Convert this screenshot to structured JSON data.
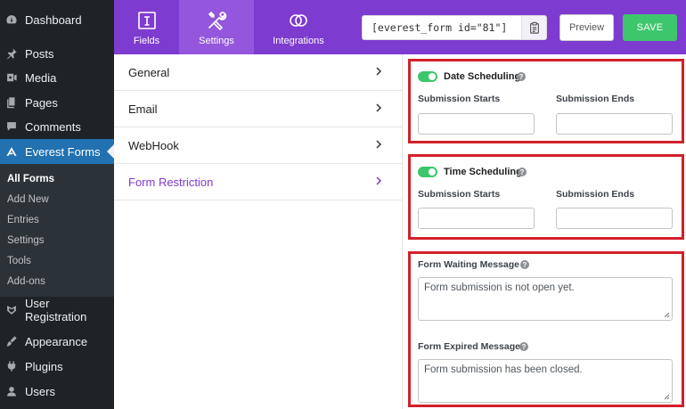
{
  "wp_menu": {
    "top_items": [
      {
        "label": "Dashboard",
        "icon": "dashboard-icon"
      },
      {
        "label": "Posts",
        "icon": "pin-icon"
      },
      {
        "label": "Media",
        "icon": "media-icon"
      },
      {
        "label": "Pages",
        "icon": "pages-icon"
      },
      {
        "label": "Comments",
        "icon": "comments-icon"
      },
      {
        "label": "Everest Forms",
        "icon": "everest-forms-icon"
      }
    ],
    "submenu": [
      "All Forms",
      "Add New",
      "Entries",
      "Settings",
      "Tools",
      "Add-ons"
    ],
    "bottom_items": [
      {
        "label": "User Registration",
        "icon": "user-registration-icon"
      },
      {
        "label": "Appearance",
        "icon": "brush-icon"
      },
      {
        "label": "Plugins",
        "icon": "plugin-icon"
      },
      {
        "label": "Users",
        "icon": "users-icon"
      }
    ]
  },
  "header": {
    "tabs": [
      {
        "label": "Fields",
        "icon": "fields-icon"
      },
      {
        "label": "Settings",
        "icon": "settings-tools-icon"
      },
      {
        "label": "Integrations",
        "icon": "integrations-icon"
      }
    ],
    "shortcode": "[everest_form id=\"81\"]",
    "preview_label": "Preview",
    "save_label": "SAVE"
  },
  "settings_nav": {
    "items": [
      "General",
      "Email",
      "WebHook",
      "Form Restriction"
    ]
  },
  "restriction": {
    "date_scheduling": {
      "label": "Date Scheduling",
      "enabled": true,
      "start_label": "Submission Starts",
      "end_label": "Submission Ends"
    },
    "time_scheduling": {
      "label": "Time Scheduling",
      "enabled": true,
      "start_label": "Submission Starts",
      "end_label": "Submission Ends"
    },
    "waiting": {
      "label": "Form Waiting Message",
      "value": "Form submission is not open yet."
    },
    "expired": {
      "label": "Form Expired Message",
      "value": "Form submission has been closed."
    },
    "help_glyph": "?"
  },
  "colors": {
    "brand_purple": "#7e3bd0",
    "save_green": "#3ec66d",
    "highlight_red": "#d3202a",
    "wp_blue": "#2271b1"
  }
}
